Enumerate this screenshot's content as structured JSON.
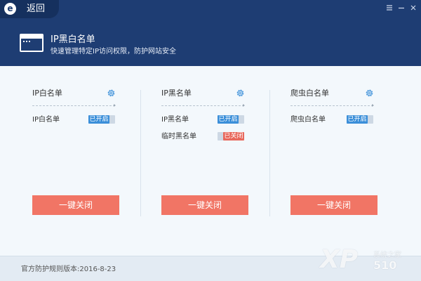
{
  "topbar": {
    "logo_letter": "e",
    "back_label": "返回",
    "menu_icon": "menu-icon",
    "minimize_icon": "minimize-icon",
    "close_icon": "close-icon"
  },
  "header": {
    "title": "IP黑白名单",
    "subtitle": "快速管理特定IP访问权限，防护网站安全"
  },
  "panels": [
    {
      "title": "IP白名单",
      "rows": [
        {
          "label": "IP白名单",
          "status": "已开启",
          "state": "on"
        }
      ],
      "button_label": "一键关闭"
    },
    {
      "title": "IP黑名单",
      "rows": [
        {
          "label": "IP黑名单",
          "status": "已开启",
          "state": "on"
        },
        {
          "label": "临时黑名单",
          "status": "已关闭",
          "state": "off"
        }
      ],
      "button_label": "一键关闭"
    },
    {
      "title": "爬虫白名单",
      "rows": [
        {
          "label": "爬虫白名单",
          "status": "已开启",
          "state": "on"
        }
      ],
      "button_label": "一键关闭"
    }
  ],
  "footer": {
    "version": "官方防护规则版本:2016-8-23"
  },
  "watermark": {
    "brand": "XP",
    "site": "系统之家",
    "number": "510"
  },
  "colors": {
    "header_bg": "#1e3d73",
    "toggle_on": "#3b8fd9",
    "toggle_off": "#e8685c",
    "button_bg": "#f17565"
  }
}
